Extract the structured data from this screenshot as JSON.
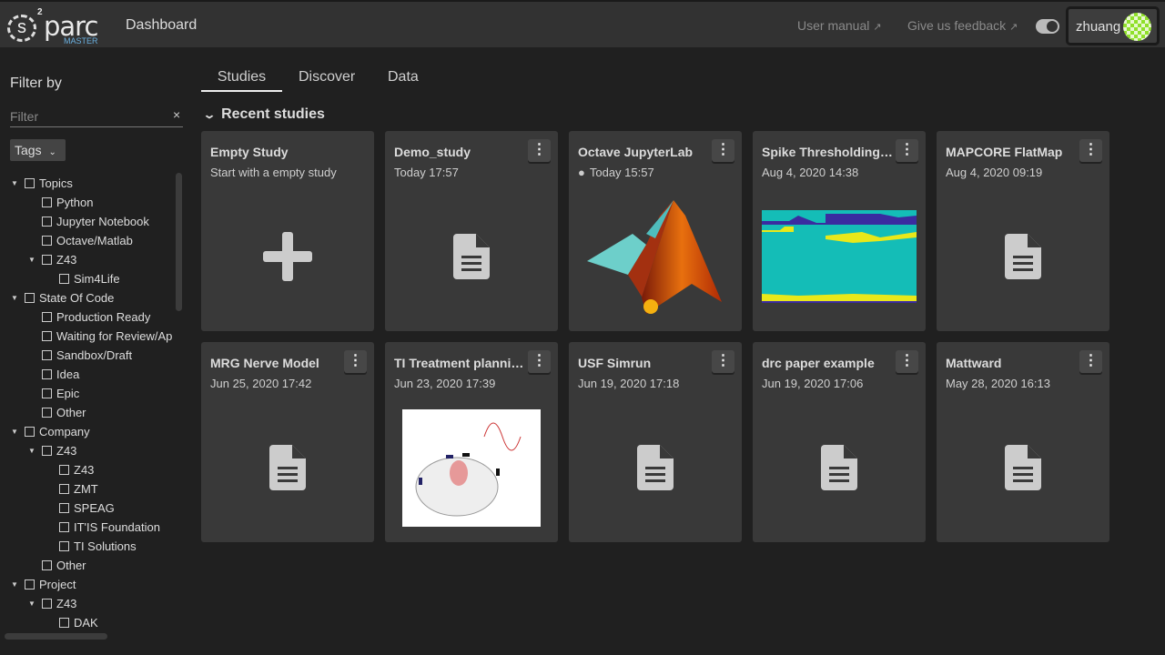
{
  "header": {
    "logo_text": "parc",
    "logo_sup": "2",
    "logo_sub": "MASTER",
    "page_title": "Dashboard",
    "user_manual": "User manual",
    "feedback": "Give us feedback",
    "username": "zhuang"
  },
  "sidebar": {
    "title": "Filter by",
    "filter_placeholder": "Filter",
    "clear": "×",
    "tags_label": "Tags",
    "tree": [
      {
        "label": "Topics",
        "level": 0,
        "expandable": true
      },
      {
        "label": "Python",
        "level": 1
      },
      {
        "label": "Jupyter Notebook",
        "level": 1
      },
      {
        "label": "Octave/Matlab",
        "level": 1
      },
      {
        "label": "Z43",
        "level": 1,
        "expandable": true
      },
      {
        "label": "Sim4Life",
        "level": 2
      },
      {
        "label": "State Of Code",
        "level": 0,
        "expandable": true
      },
      {
        "label": "Production Ready",
        "level": 1
      },
      {
        "label": "Waiting for Review/Ap",
        "level": 1
      },
      {
        "label": "Sandbox/Draft",
        "level": 1
      },
      {
        "label": "Idea",
        "level": 1
      },
      {
        "label": "Epic",
        "level": 1
      },
      {
        "label": "Other",
        "level": 1
      },
      {
        "label": "Company",
        "level": 0,
        "expandable": true
      },
      {
        "label": "Z43",
        "level": 1,
        "expandable": true
      },
      {
        "label": "Z43",
        "level": 2
      },
      {
        "label": "ZMT",
        "level": 2
      },
      {
        "label": "SPEAG",
        "level": 2
      },
      {
        "label": "IT'IS Foundation",
        "level": 2
      },
      {
        "label": "TI Solutions",
        "level": 2
      },
      {
        "label": "Other",
        "level": 1
      },
      {
        "label": "Project",
        "level": 0,
        "expandable": true
      },
      {
        "label": "Z43",
        "level": 1,
        "expandable": true
      },
      {
        "label": "DAK",
        "level": 2
      }
    ]
  },
  "tabs": [
    "Studies",
    "Discover",
    "Data"
  ],
  "active_tab": "Studies",
  "section_title": "Recent studies",
  "cards": [
    {
      "title": "Empty Study",
      "sub": "Start with a empty study",
      "thumb": "plus",
      "menu": false
    },
    {
      "title": "Demo_study",
      "sub": "Today 17:57",
      "thumb": "doc",
      "menu": true
    },
    {
      "title": "Octave JupyterLab",
      "sub": "Today 15:57",
      "thumb": "matlab",
      "menu": true,
      "shared": true
    },
    {
      "title": "Spike Thresholding Tutorial",
      "sub": "Aug 4, 2020 14:38",
      "thumb": "spike",
      "menu": true
    },
    {
      "title": "MAPCORE FlatMap",
      "sub": "Aug 4, 2020 09:19",
      "thumb": "doc",
      "menu": true
    },
    {
      "title": "MRG Nerve Model",
      "sub": "Jun 25, 2020 17:42",
      "thumb": "doc",
      "menu": true
    },
    {
      "title": "TI Treatment planning",
      "sub": "Jun 23, 2020 17:39",
      "thumb": "brain",
      "menu": true
    },
    {
      "title": "USF Simrun",
      "sub": "Jun 19, 2020 17:18",
      "thumb": "doc",
      "menu": true
    },
    {
      "title": "drc paper example",
      "sub": "Jun 19, 2020 17:06",
      "thumb": "doc",
      "menu": true
    },
    {
      "title": "Mattward",
      "sub": "May 28, 2020 16:13",
      "thumb": "doc",
      "menu": true
    }
  ],
  "colors": {
    "header": "#323232",
    "background": "#202020",
    "card": "#393939",
    "avatar": "#8fe02a"
  }
}
